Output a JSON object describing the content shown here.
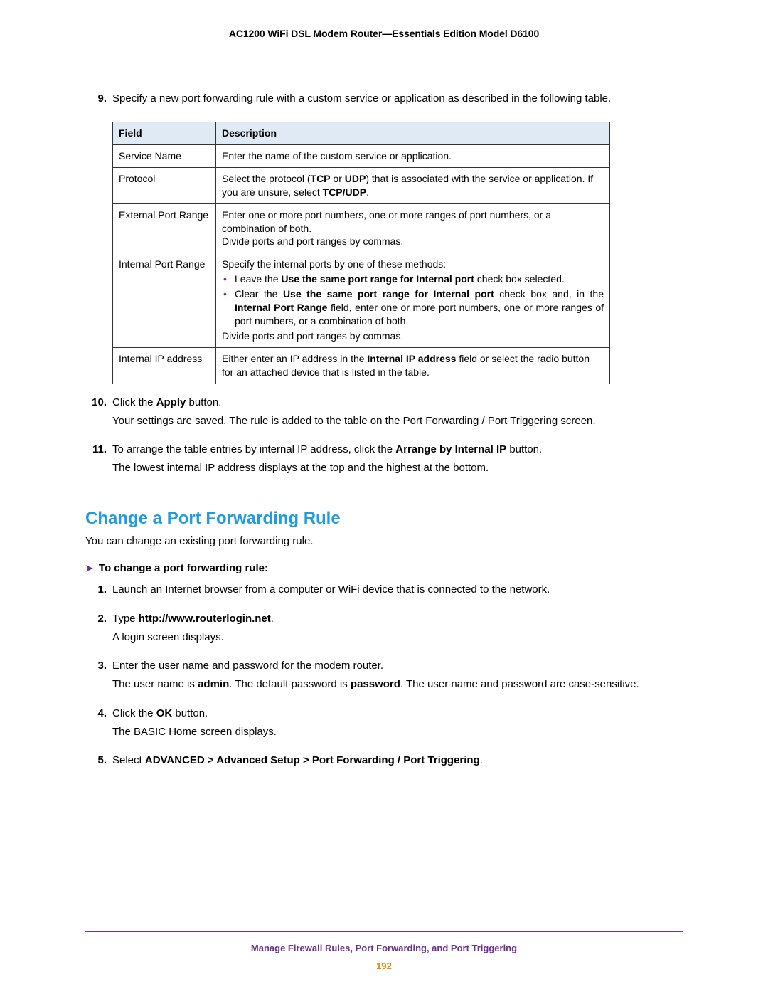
{
  "header": {
    "title": "AC1200 WiFi DSL Modem Router—Essentials Edition Model D6100"
  },
  "step9": {
    "num": "9.",
    "text": "Specify a new port forwarding rule with a custom service or application as described in the following table."
  },
  "table": {
    "headers": {
      "field": "Field",
      "description": "Description"
    },
    "rows": {
      "r0": {
        "field": "Service Name",
        "desc": "Enter the name of the custom service or application."
      },
      "r1": {
        "field": "Protocol",
        "desc_a": "Select the protocol (",
        "desc_b": "TCP",
        "desc_c": " or ",
        "desc_d": "UDP",
        "desc_e": ") that is associated with the service or application. If you are unsure, select ",
        "desc_f": "TCP/UDP",
        "desc_g": "."
      },
      "r2": {
        "field": "External Port Range",
        "line1": "Enter one or more port numbers, one or more ranges of port numbers, or a combination of both.",
        "line2": "Divide ports and port ranges by commas."
      },
      "r3": {
        "field": "Internal Port Range",
        "line1": "Specify the internal ports by one of these methods:",
        "b1a": "Leave the ",
        "b1b": "Use the same port range for Internal port",
        "b1c": " check box selected.",
        "b2a": "Clear the ",
        "b2b": "Use the same port range for Internal port",
        "b2c": " check box and, in the ",
        "b2d": "Internal Port Range",
        "b2e": " field, enter one or more port numbers, one or more ranges of port numbers, or a combination of both.",
        "line3": "Divide ports and port ranges by commas."
      },
      "r4": {
        "field": "Internal IP address",
        "a": "Either enter an IP address in the ",
        "b": "Internal IP address",
        "c": " field or select the radio button for an attached device that is listed in the table."
      }
    }
  },
  "step10": {
    "num": "10.",
    "l1a": "Click the ",
    "l1b": "Apply",
    "l1c": " button.",
    "l2": "Your settings are saved. The rule is added to the table on the Port Forwarding / Port Triggering screen."
  },
  "step11": {
    "num": "11.",
    "l1a": "To arrange the table entries by internal IP address, click the ",
    "l1b": "Arrange by Internal IP",
    "l1c": " button.",
    "l2": "The lowest internal IP address displays at the top and the highest at the bottom."
  },
  "section": {
    "heading": "Change a Port Forwarding Rule",
    "intro": "You can change an existing port forwarding rule.",
    "task_arrow": "➤",
    "task": "To change a port forwarding rule:"
  },
  "steps2": {
    "s1": {
      "num": "1.",
      "text": "Launch an Internet browser from a computer or WiFi device that is connected to the network."
    },
    "s2": {
      "num": "2.",
      "a": "Type ",
      "b": "http://www.routerlogin.net",
      "c": ".",
      "l2": "A login screen displays."
    },
    "s3": {
      "num": "3.",
      "l1": "Enter the user name and password for the modem router.",
      "l2a": "The user name is ",
      "l2b": "admin",
      "l2c": ". The default password is ",
      "l2d": "password",
      "l2e": ". The user name and password are case-sensitive."
    },
    "s4": {
      "num": "4.",
      "a": "Click the ",
      "b": "OK",
      "c": " button.",
      "l2": "The BASIC Home screen displays."
    },
    "s5": {
      "num": "5.",
      "a": "Select ",
      "b": "ADVANCED > Advanced Setup > Port Forwarding / Port Triggering",
      "c": "."
    }
  },
  "footer": {
    "text": "Manage Firewall Rules, Port Forwarding, and Port Triggering",
    "page": "192"
  }
}
